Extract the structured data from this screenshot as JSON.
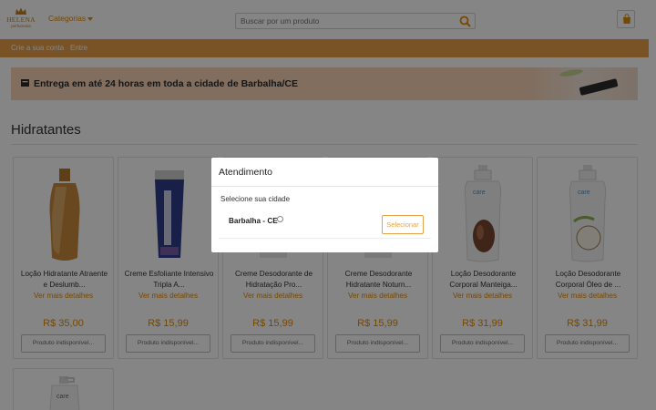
{
  "header": {
    "logo_brand": "HELENA",
    "logo_sub": "perfumaria",
    "categories_label": "Categorias",
    "search_placeholder": "Buscar por um produto"
  },
  "account_bar": {
    "create_account": "Crie a sua conta",
    "login": "Entre"
  },
  "banner": {
    "text": "Entrega em até 24 horas em toda a cidade de Barbalha/CE"
  },
  "section": {
    "title": "Hidratantes"
  },
  "products": [
    {
      "name": "Loção Hidratante Atraente e Deslumb...",
      "more": "Ver mais detalhes",
      "price": "R$ 35,00",
      "status": "Produto indisponível..."
    },
    {
      "name": "Creme Esfoliante Intensivo Tripla A...",
      "more": "Ver mais detalhes",
      "price": "R$ 15,99",
      "status": "Produto indisponível..."
    },
    {
      "name": "Creme Desodorante de Hidratação Pro...",
      "more": "Ver mais detalhes",
      "price": "R$ 15,99",
      "status": "Produto indisponível..."
    },
    {
      "name": "Creme Desodorante Hidratante Noturn...",
      "more": "Ver mais detalhes",
      "price": "R$ 15,99",
      "status": "Produto indisponível..."
    },
    {
      "name": "Loção Desodorante Corporal Manteiga...",
      "more": "Ver mais detalhes",
      "price": "R$ 31,99",
      "status": "Produto indisponível..."
    },
    {
      "name": "Loção Desodorante Corporal Óleo de ...",
      "more": "Ver mais detalhes",
      "price": "R$ 31,99",
      "status": "Produto indisponível..."
    }
  ],
  "modal": {
    "title": "Atendimento",
    "subtitle": "Selecione sua cidade",
    "city": "Barbalha - CE",
    "select_button": "Selecionar"
  },
  "colors": {
    "accent": "#e58a00",
    "bar": "#e8a04a",
    "banner_bg": "#f7d3b6"
  }
}
